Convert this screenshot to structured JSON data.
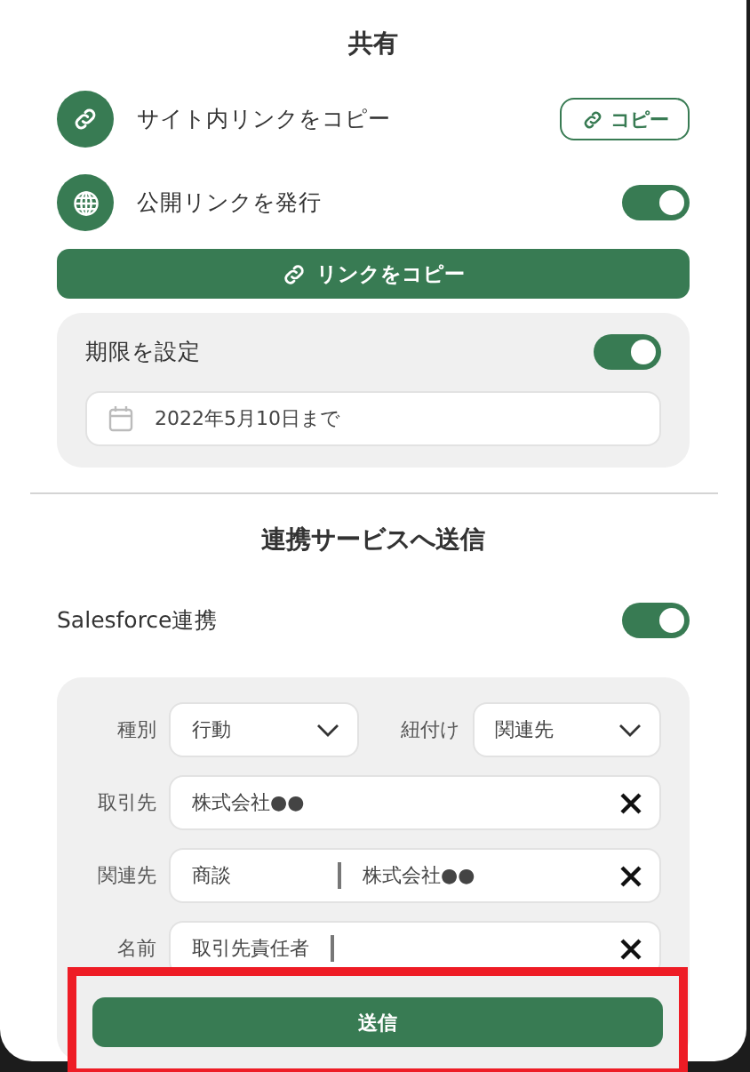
{
  "share": {
    "title": "共有",
    "site_link": {
      "label": "サイト内リンクをコピー",
      "button": "コピー"
    },
    "public_link": {
      "label": "公開リンクを発行",
      "on": true,
      "button": "リンクをコピー"
    },
    "expiry": {
      "label": "期限を設定",
      "on": true,
      "date": "2022年5月10日まで"
    }
  },
  "send": {
    "title": "連携サービスへ送信",
    "integration": {
      "label": "Salesforce連携",
      "on": true
    },
    "selects": [
      {
        "label": "種別",
        "value": "行動"
      },
      {
        "label": "紐付け",
        "value": "関連先"
      }
    ],
    "fields": [
      {
        "label": "取引先",
        "values": [
          "株式会社●●"
        ],
        "cursor": false
      },
      {
        "label": "関連先",
        "values": [
          "商談",
          "株式会社●●"
        ],
        "cursor": false
      },
      {
        "label": "名前",
        "values": [
          "取引先責任者"
        ],
        "cursor": true
      }
    ],
    "button": "送信"
  },
  "annotation": {
    "kind": "highlight"
  }
}
